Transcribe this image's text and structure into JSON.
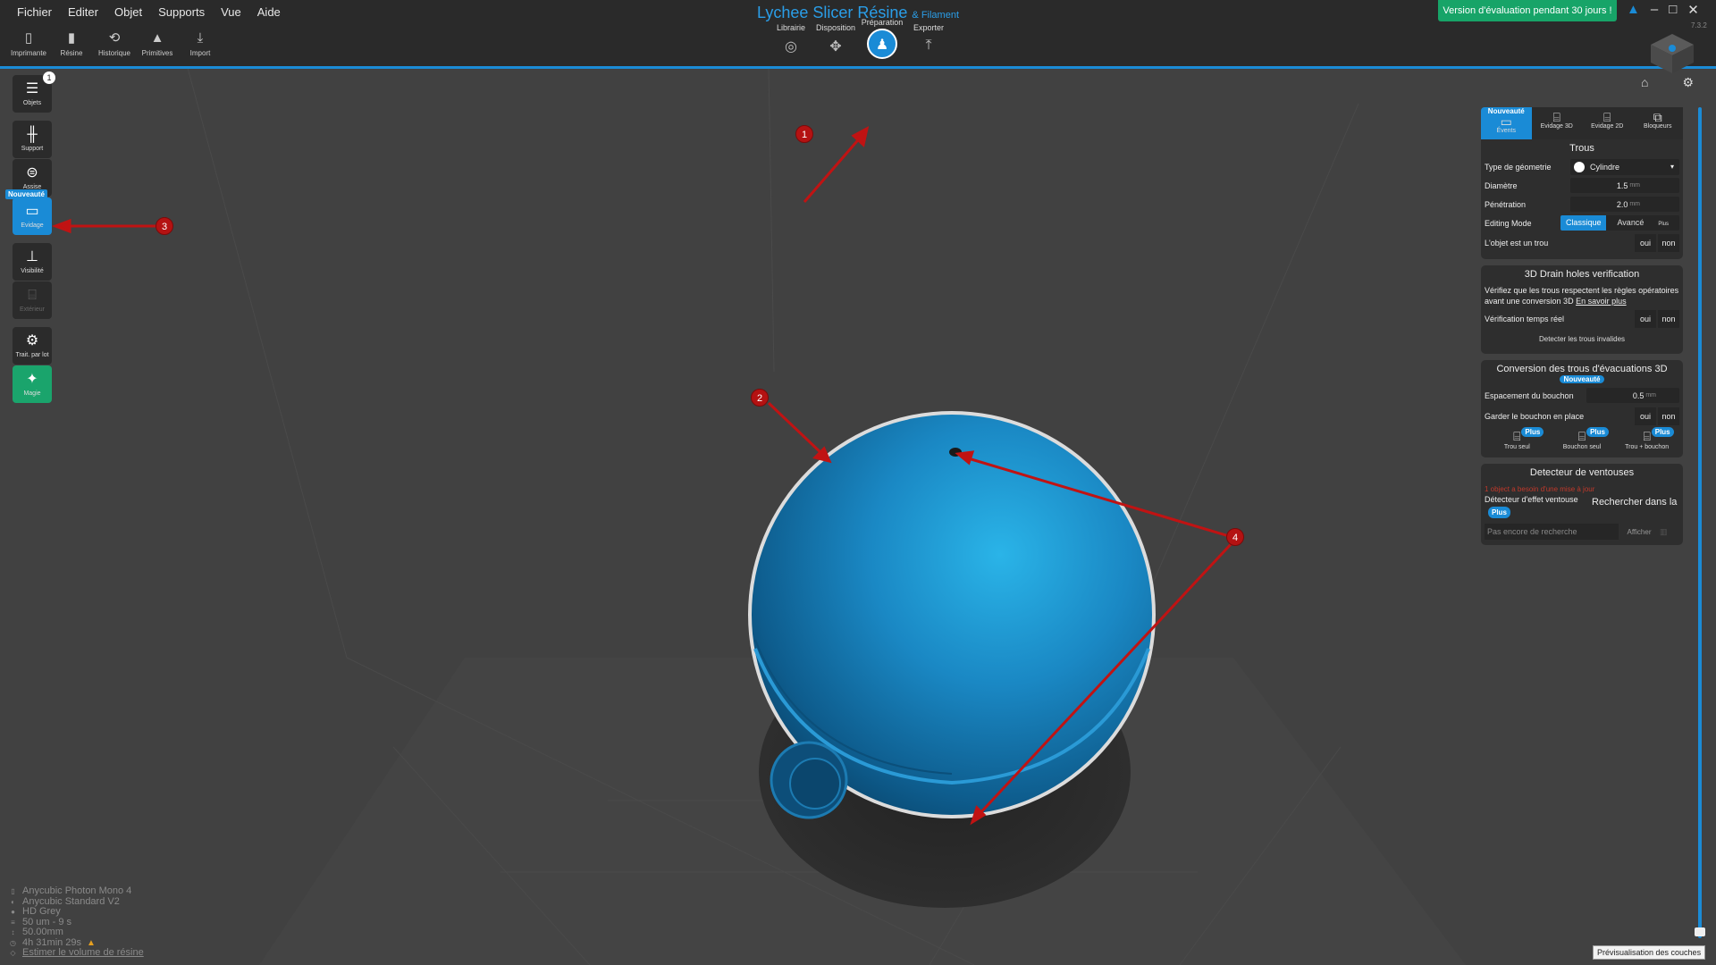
{
  "menu": [
    "Fichier",
    "Editer",
    "Objet",
    "Supports",
    "Vue",
    "Aide"
  ],
  "app_title": "Lychee Slicer Résine",
  "app_subtitle": "& Filament",
  "trial_label": "Version d'évaluation pendant 30 jours !",
  "version": "7.3.2",
  "toolbar": [
    {
      "label": "Imprimante",
      "icon": "printer-icon"
    },
    {
      "label": "Résine",
      "icon": "resin-bottle-icon"
    },
    {
      "label": "Historique",
      "icon": "history-icon"
    },
    {
      "label": "Primitives",
      "icon": "primitives-icon"
    },
    {
      "label": "Import",
      "icon": "import-icon"
    }
  ],
  "steps": [
    {
      "label": "Librairie",
      "icon": "library-icon"
    },
    {
      "label": "Disposition",
      "icon": "move-icon"
    },
    {
      "label": "Préparation",
      "icon": "preparation-icon",
      "active": true
    },
    {
      "label": "Exporter",
      "icon": "export-icon"
    }
  ],
  "sidebar": {
    "objects_label": "Objets",
    "objects_count": "1",
    "support_label": "Support",
    "assise_label": "Assise",
    "evidage_label": "Evidage",
    "evidage_tag": "Nouveauté",
    "visibilite_label": "Visibilité",
    "exterieur_label": "Extérieur",
    "batch_label": "Trait. par lot",
    "magie_label": "Magie"
  },
  "panel": {
    "tabs": [
      {
        "label": "Évents",
        "tag": "Nouveauté",
        "active": true
      },
      {
        "label": "Evidage 3D"
      },
      {
        "label": "Evidage 2D"
      },
      {
        "label": "Bloqueurs"
      }
    ],
    "holes": {
      "title": "Trous",
      "geometry_label": "Type de géometrie",
      "geometry_value": "Cylindre",
      "diameter_label": "Diamètre",
      "diameter_value": "1.5",
      "penetration_label": "Pénétration",
      "penetration_value": "2.0",
      "unit": "mm",
      "editing_label": "Editing Mode",
      "mode_classic": "Classique",
      "mode_advanced": "Avancé",
      "mode_advanced_tag": "Plus",
      "is_hole_label": "L'objet est un trou",
      "yes": "oui",
      "no": "non"
    },
    "drain": {
      "title": "3D Drain holes verification",
      "text": "Vérifiez que les trous respectent les règles opératoires avant une conversion 3D",
      "link": "En savoir plus",
      "realtime_label": "Vérification temps réel",
      "detect_button": "Detecter les trous invalides"
    },
    "conversion": {
      "title": "Conversion des trous d'évacuations 3D",
      "tag": "Nouveauté",
      "spacing_label": "Espacement du bouchon",
      "spacing_value": "0.5",
      "keep_label": "Garder le bouchon en place",
      "options": [
        {
          "label": "Trou seul",
          "tag": "Plus"
        },
        {
          "label": "Bouchon seul",
          "tag": "Plus"
        },
        {
          "label": "Trou + bouchon",
          "tag": "Plus"
        }
      ]
    },
    "suction": {
      "title": "Detecteur de ventouses",
      "warning": "1 object a besoin d'une mise à jour",
      "detector_label": "Détecteur d'effet ventouse",
      "detector_tag": "Plus",
      "search_label": "Rechercher dans la",
      "not_searched": "Pas encore de recherche",
      "show_label": "Afficher"
    }
  },
  "layer_preview": "Prévisualisation des couches",
  "info": {
    "printer": "Anycubic Photon Mono 4",
    "resin": "Anycubic Standard V2",
    "color": "HD Grey",
    "layer": "50 um - 9 s",
    "height": "50.00mm",
    "time": "4h 31min 29s",
    "estimate": "Estimer le volume de résine"
  },
  "annotations": [
    "1",
    "2",
    "3",
    "4"
  ],
  "colors": {
    "accent": "#1a8bd6",
    "trial": "#17a468",
    "model": "#1e7db8",
    "annotation": "#b41212"
  }
}
